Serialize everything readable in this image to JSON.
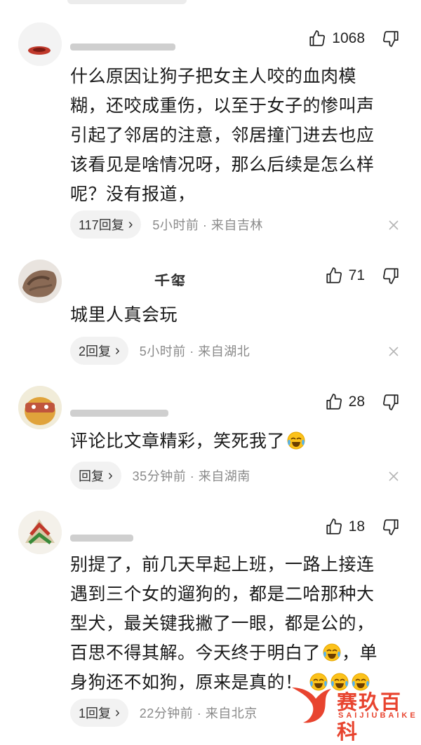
{
  "comments": [
    {
      "username": "",
      "likes": "1068",
      "text": "什么原因让狗子把女主人咬的血肉模糊，还咬成重伤，以至于女子的惨叫声引起了邻居的注意，邻居撞门进去也应该看见是啥情况呀，那么后续是怎么样呢？没有报道，",
      "reply_label": "117回复",
      "meta": "5小时前 · 来自吉林"
    },
    {
      "username": "千玺",
      "likes": "71",
      "text": "城里人真会玩",
      "reply_label": "2回复",
      "meta": "5小时前 · 来自湖北"
    },
    {
      "username": "",
      "likes": "28",
      "text": "评论比文章精彩，笑死我了",
      "reply_label": "回复",
      "meta": "35分钟前 · 来自湖南"
    },
    {
      "username": "",
      "likes": "18",
      "text_lines": [
        "别提了，前几天早起上班，一路上接连",
        "遇到三个女的遛狗的，都是二哈那种大",
        "型犬，最关键我撇了一眼，都是公的，",
        "百思不得其解。今天终于明白了",
        "，单",
        "身狗还不如狗，原来是真的！"
      ],
      "reply_label": "1回复",
      "meta": "22分钟前 · 来自北京"
    }
  ],
  "watermark": {
    "brand": "赛玖百科",
    "sub": "SAIJIUBAIKE"
  },
  "colors": {
    "watermark": "#e8442f",
    "meta": "#8a8a8a",
    "reply_bg": "#f2f2f2"
  },
  "icons": [
    "thumbs-up-icon",
    "thumbs-down-icon",
    "close-icon",
    "crying-laughing-emoji",
    "chevron-right-icon"
  ]
}
